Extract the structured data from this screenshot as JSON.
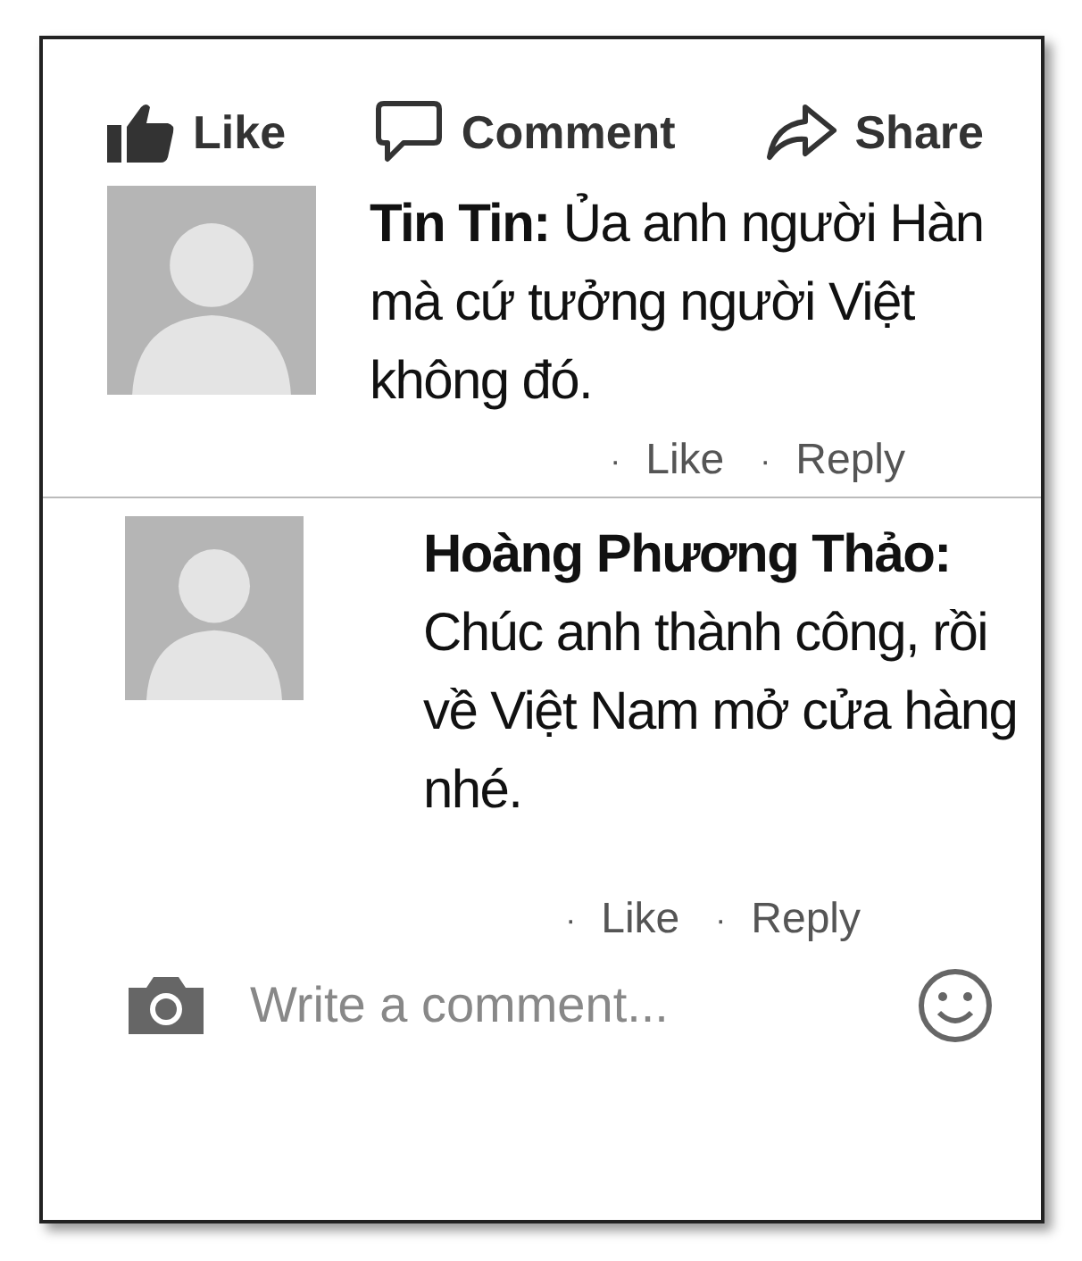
{
  "actions": [
    {
      "kind": "like",
      "label": "Like"
    },
    {
      "kind": "comment",
      "label": "Comment"
    },
    {
      "kind": "share",
      "label": "Share"
    }
  ],
  "comments": [
    {
      "author": "Tin Tin:",
      "text": "Ủa anh người Hàn mà cứ tưởng người Việt không đó.",
      "actions": [
        {
          "separator": "·",
          "label": "Like"
        },
        {
          "separator": "·",
          "label": "Reply"
        }
      ]
    },
    {
      "author": "Hoàng Phương Thảo:",
      "text": "Chúc anh thành công, rồi về Việt Nam mở cửa hàng nhé.",
      "actions": [
        {
          "separator": "·",
          "label": "Like"
        },
        {
          "separator": "·",
          "label": "Reply"
        }
      ]
    }
  ],
  "composer": {
    "placeholder": "Write a comment..."
  }
}
